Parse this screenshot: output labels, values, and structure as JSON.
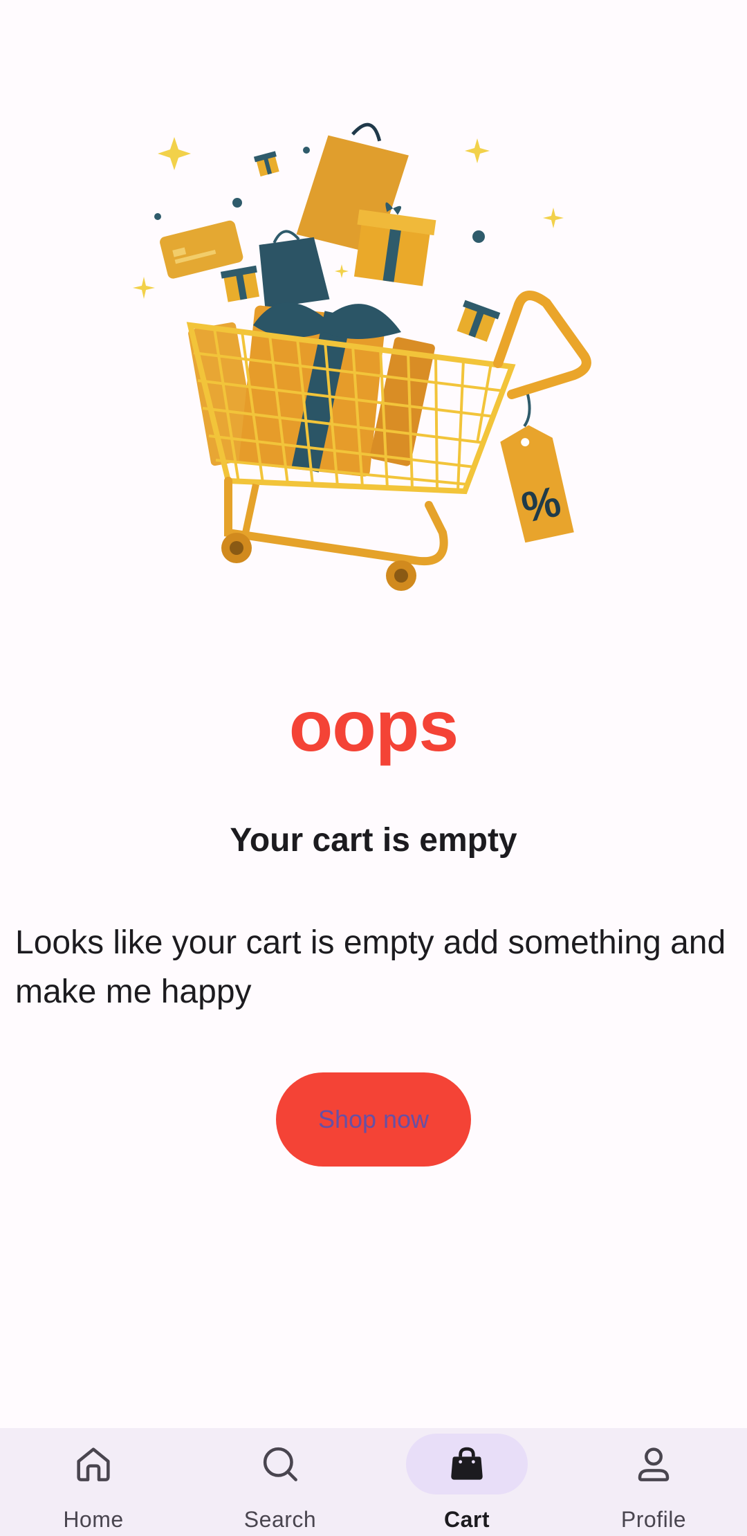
{
  "empty_state": {
    "title": "oops",
    "subtitle": "Your cart is empty",
    "description": "Looks like your cart is empty add something and make me happy",
    "button_label": "Shop now",
    "illustration": "shopping-cart-with-gifts"
  },
  "bottom_nav": {
    "items": [
      {
        "label": "Home",
        "icon": "home-icon",
        "active": false
      },
      {
        "label": "Search",
        "icon": "search-icon",
        "active": false
      },
      {
        "label": "Cart",
        "icon": "shopping-bag-icon",
        "active": true
      },
      {
        "label": "Profile",
        "icon": "profile-icon",
        "active": false
      }
    ]
  },
  "colors": {
    "accent_red": "#f44336",
    "nav_background": "#f3edf7",
    "active_indicator": "#e8def8",
    "button_text": "#6750a4"
  }
}
